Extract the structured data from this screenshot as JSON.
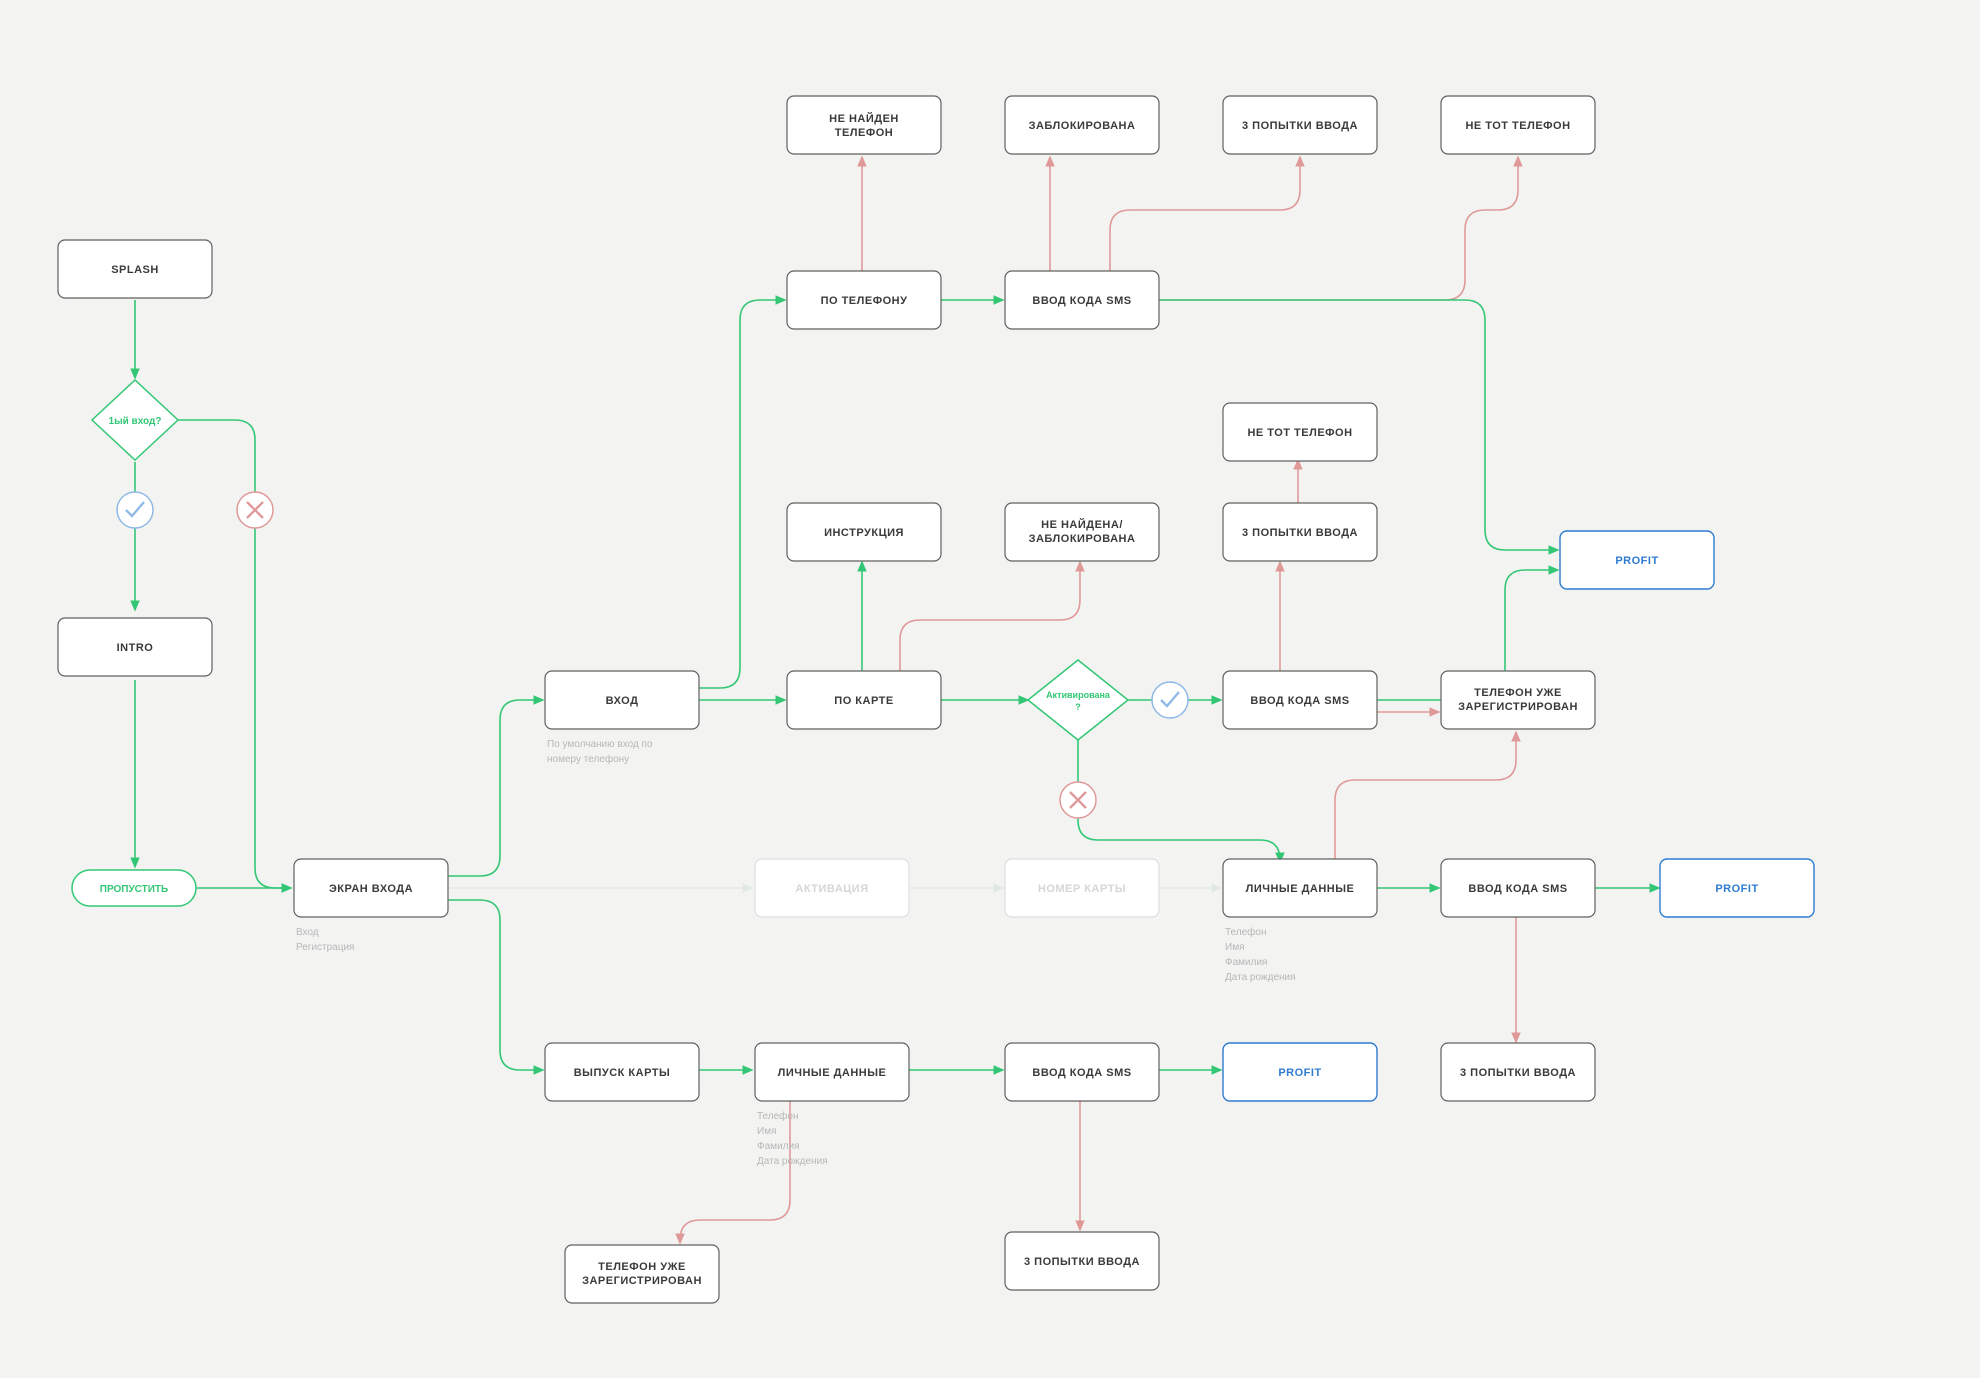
{
  "nodes": {
    "splash": "SPLASH",
    "intro": "INTRO",
    "first_entry_q": "1ый вход?",
    "skip": "ПРОПУСТИТЬ",
    "login_screen": "ЭКРАН ВХОДА",
    "login": "ВХОД",
    "by_phone": "ПО ТЕЛЕФОНУ",
    "by_card": "ПО КАРТЕ",
    "instruction": "ИНСТРУКЦИЯ",
    "sms_code": "ВВОД КОДА SMS",
    "phone_not_found_1": "НЕ НАЙДЕН",
    "phone_not_found_2": "ТЕЛЕФОН",
    "blocked": "ЗАБЛОКИРОВАНА",
    "three_attempts": "3 ПОПЫТКИ ВВОДА",
    "wrong_phone": "НЕ ТОТ ТЕЛЕФОН",
    "not_found_blocked_1": "НЕ НАЙДЕНА/",
    "not_found_blocked_2": "ЗАБЛОКИРОВАНА",
    "activated_q_1": "Активирована",
    "activated_q_2": "?",
    "phone_registered_1": "ТЕЛЕФОН УЖЕ",
    "phone_registered_2": "ЗАРЕГИСТРИРОВАН",
    "activation": "АКТИВАЦИЯ",
    "card_number": "НОМЕР КАРТЫ",
    "personal_data": "ЛИЧНЫЕ ДАННЫЕ",
    "card_issue": "ВЫПУСК КАРТЫ",
    "profit": "PROFIT"
  },
  "notes": {
    "login_screen_1": "Вход",
    "login_screen_2": "Регистрация",
    "login_1": "По умолчанию вход по",
    "login_2": "номеру телефону",
    "personal_1": "Телефон",
    "personal_2": "Имя",
    "personal_3": "Фамилия",
    "personal_4": "Дата рождения"
  },
  "colors": {
    "green": "#33c775",
    "red": "#e09999",
    "blue": "#2e7cd1",
    "bg": "#f3f4f2"
  }
}
